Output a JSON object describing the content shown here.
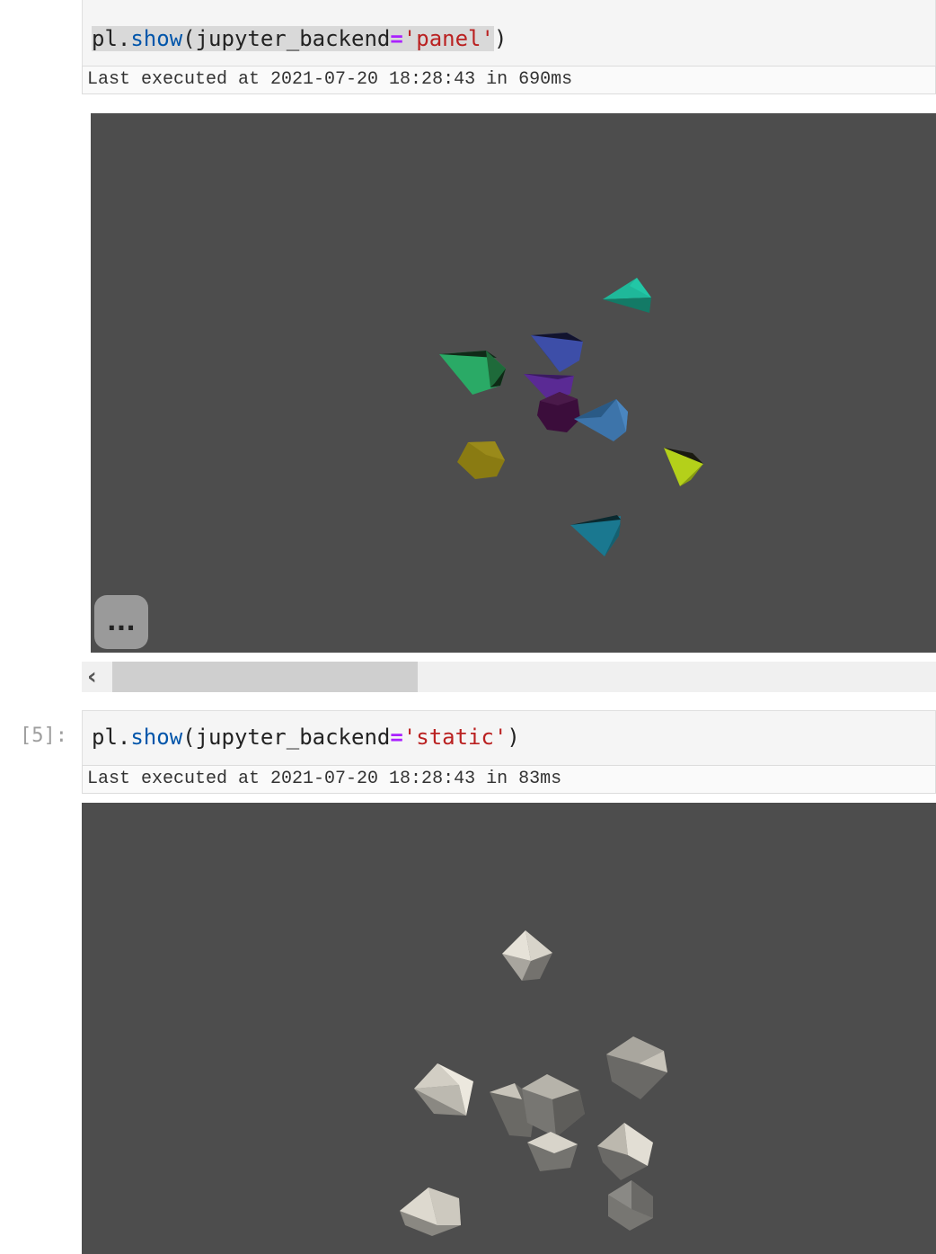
{
  "cells": [
    {
      "prompt": "",
      "code": {
        "obj": "pl.",
        "fn": "show",
        "open": "(",
        "param": "jupyter_backend",
        "op": "=",
        "str": "'panel'",
        "close": ")"
      },
      "exec_text": "Last executed at 2021-07-20 18:28:43 in 690ms",
      "viewer": {
        "background": "#4d4d4d",
        "menu_label": "...",
        "shapes": [
          {
            "name": "teal-pyramid",
            "color": "#1a9e86"
          },
          {
            "name": "navy-pyramid",
            "color": "#3a4aa0"
          },
          {
            "name": "green-pyramid",
            "color": "#2a9e5e"
          },
          {
            "name": "purple-pyramid",
            "color": "#5a2a90"
          },
          {
            "name": "dark-purple-blob",
            "color": "#3a0f3a"
          },
          {
            "name": "steelblue-pyramid",
            "color": "#3a6aa0"
          },
          {
            "name": "olive-blob",
            "color": "#8a7a10"
          },
          {
            "name": "lime-pyramid",
            "color": "#b8d010"
          },
          {
            "name": "cyan-pyramid",
            "color": "#1a7890"
          }
        ]
      },
      "scrollbar": {
        "left_arrow": "‹"
      }
    },
    {
      "prompt": "[5]:",
      "code": {
        "obj": "pl.",
        "fn": "show",
        "open": "(",
        "param": "jupyter_backend",
        "op": "=",
        "str": "'static'",
        "close": ")"
      },
      "exec_text": "Last executed at 2021-07-20 18:28:43 in 83ms",
      "viewer": {
        "background": "#4d4d4d",
        "shape_color": "#e8e4da"
      }
    }
  ]
}
